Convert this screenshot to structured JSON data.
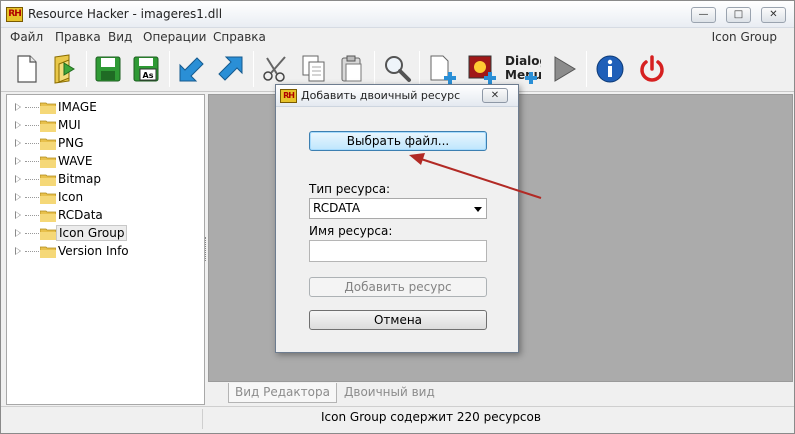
{
  "window": {
    "title": "Resource Hacker - imageres1.dll",
    "app_icon_text": "RH",
    "minimize_glyph": "—",
    "maximize_glyph": "□",
    "close_glyph": "✕"
  },
  "menu": {
    "items": [
      "Файл",
      "Правка",
      "Вид",
      "Операции",
      "Справка"
    ],
    "right_label": "Icon Group"
  },
  "toolbar": {
    "buttons": [
      "new-file-icon",
      "open-file-icon",
      "save-icon",
      "save-as-icon",
      "back-icon",
      "forward-icon",
      "cut-icon",
      "copy-icon",
      "paste-icon",
      "find-icon",
      "add-resource-icon",
      "add-image-icon",
      "add-dialog-menu-icon",
      "run-script-icon",
      "info-icon",
      "power-icon"
    ],
    "save_as_label": "As",
    "dialog_menu_label_1": "Dialog",
    "dialog_menu_label_2": "Menu"
  },
  "tree": {
    "items": [
      {
        "label": "IMAGE"
      },
      {
        "label": "MUI"
      },
      {
        "label": "PNG"
      },
      {
        "label": "WAVE"
      },
      {
        "label": "Bitmap"
      },
      {
        "label": "Icon"
      },
      {
        "label": "RCData"
      },
      {
        "label": "Icon Group",
        "selected": true
      },
      {
        "label": "Version Info"
      }
    ]
  },
  "tabs": {
    "editor": "Вид Редактора",
    "binary": "Двоичный вид"
  },
  "status": {
    "text": "Icon Group содержит 220 ресурсов"
  },
  "dialog": {
    "title": "Добавить двоичный ресурс",
    "icon_text": "RH",
    "close_glyph": "✕",
    "choose_file_button": "Выбрать файл...",
    "resource_type_label": "Тип ресурса:",
    "resource_type_value": "RCDATA",
    "resource_name_label": "Имя ресурса:",
    "resource_name_value": "",
    "add_button": "Добавить ресурс",
    "cancel_button": "Отмена"
  },
  "colors": {
    "annotation_arrow": "#b22a25",
    "primary_button_border": "#3c7fb1",
    "editor_background": "#ababab"
  }
}
